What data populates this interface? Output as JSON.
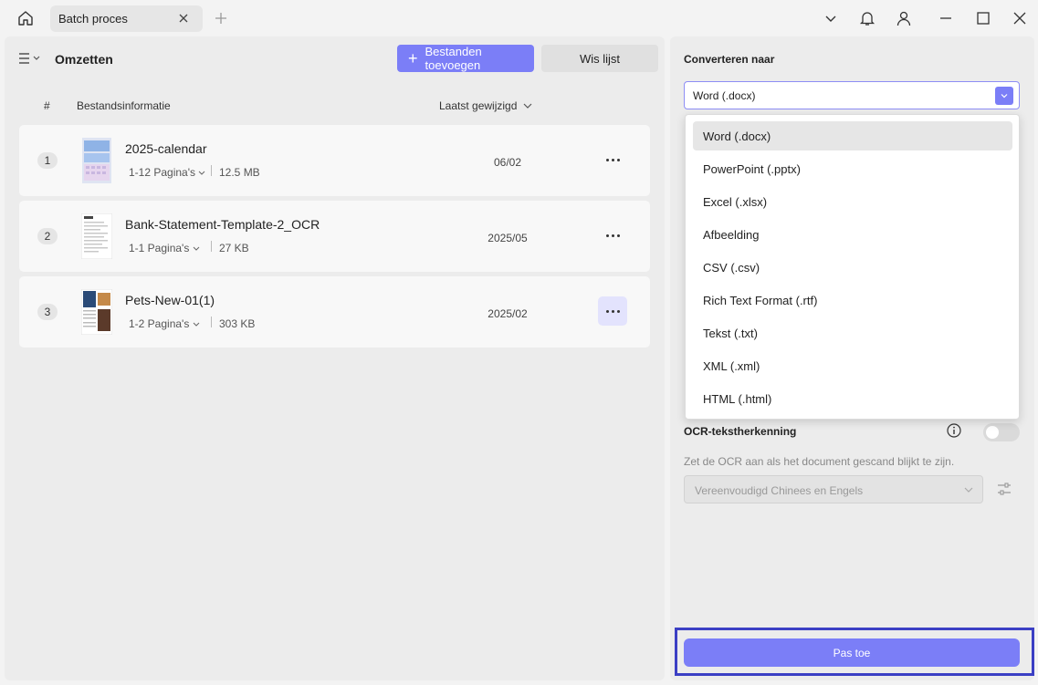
{
  "tab": {
    "title": "Batch proces"
  },
  "left": {
    "title": "Omzetten",
    "add_files_label": "Bestanden toevoegen",
    "clear_label": "Wis lijst",
    "columns": {
      "hash": "#",
      "info": "Bestandsinformatie",
      "modified": "Laatst gewijzigd"
    },
    "files": [
      {
        "num": "1",
        "name": "2025-calendar",
        "pages": "1-12 Pagina's",
        "size": "12.5 MB",
        "date": "06/02"
      },
      {
        "num": "2",
        "name": "Bank-Statement-Template-2_OCR",
        "pages": "1-1 Pagina's",
        "size": "27 KB",
        "date": "2025/05"
      },
      {
        "num": "3",
        "name": "Pets-New-01(1)",
        "pages": "1-2 Pagina's",
        "size": "303 KB",
        "date": "2025/02"
      }
    ]
  },
  "right": {
    "convert_label": "Converteren naar",
    "selected_format": "Word (.docx)",
    "formats": [
      "Word (.docx)",
      "PowerPoint (.pptx)",
      "Excel (.xlsx)",
      "Afbeelding",
      "CSV (.csv)",
      "Rich Text Format (.rtf)",
      "Tekst (.txt)",
      "XML (.xml)",
      "HTML (.html)"
    ],
    "ocr_label": "OCR-tekstherkenning",
    "ocr_desc": "Zet de OCR aan als het document gescand blijkt te zijn.",
    "ocr_language": "Vereenvoudigd Chinees en Engels",
    "apply_label": "Pas toe"
  },
  "colors": {
    "accent": "#7b7ef7",
    "highlight_frame": "#3b3fc4"
  }
}
